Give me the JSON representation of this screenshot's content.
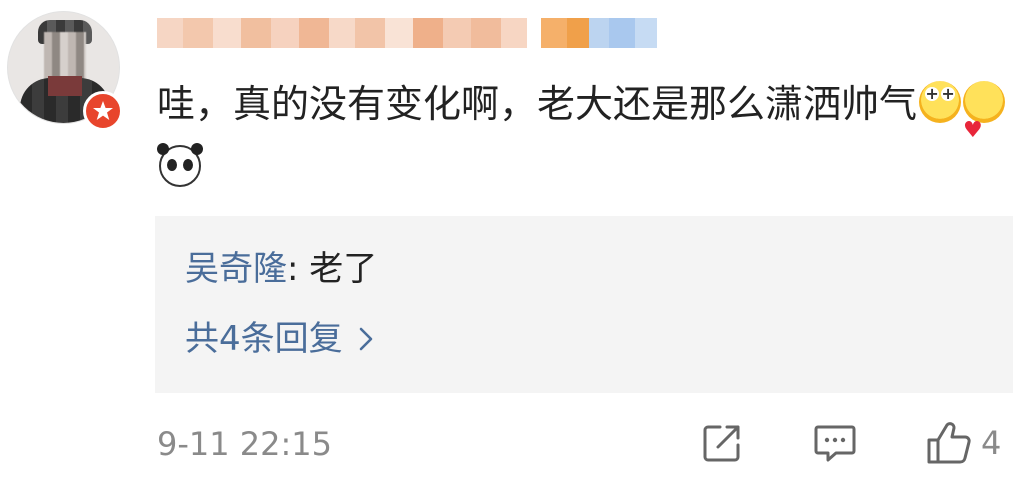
{
  "comment": {
    "username": "",
    "text": "哇，真的没有变化啊，老大还是那么潇洒帅气",
    "emojis": [
      "star-eyes-emoji",
      "heart-face-emoji",
      "panda-emoji"
    ],
    "timestamp": "9-11 22:15",
    "like_count": "4"
  },
  "reply_preview": {
    "author": "吴奇隆",
    "separator": ": ",
    "content": "老了",
    "more_label": "共4条回复",
    "more_chevron": "›"
  },
  "icons": {
    "badge": "vip-badge-icon",
    "share": "share-icon",
    "reply": "comment-icon",
    "like": "thumbs-up-icon"
  },
  "colors": {
    "link": "#4a6d9a",
    "badge": "#e8452c",
    "reply_bg": "#f4f4f4",
    "meta": "#8a8a8a"
  }
}
